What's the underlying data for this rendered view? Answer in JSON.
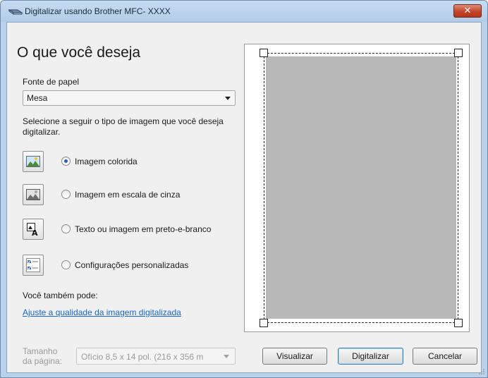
{
  "window": {
    "title": "Digitalizar usando Brother MFC- XXXX",
    "close_label": "✕"
  },
  "main": {
    "heading": "O que você deseja",
    "paper_source_label": "Fonte de papel",
    "paper_source_value": "Mesa",
    "instruction": "Selecione a seguir o tipo de imagem que você deseja digitalizar.",
    "image_types": [
      {
        "label": "Imagem colorida",
        "selected": true,
        "icon": "color-picture-icon"
      },
      {
        "label": "Imagem em escala de cinza",
        "selected": false,
        "icon": "grayscale-picture-icon"
      },
      {
        "label": "Texto ou imagem em preto-e-branco",
        "selected": false,
        "icon": "black-white-text-icon"
      },
      {
        "label": "Configurações personalizadas",
        "selected": false,
        "icon": "custom-settings-icon"
      }
    ],
    "also_label": "Você também pode:",
    "adjust_link": "Ajuste a qualidade da imagem digitalizada",
    "page_size_label_line1": "Tamanho",
    "page_size_label_line2": "da página:",
    "page_size_value": "Ofício 8,5 x 14 pol. (216 x 356 m"
  },
  "buttons": {
    "preview": "Visualizar",
    "scan": "Digitalizar",
    "cancel": "Cancelar"
  },
  "colors": {
    "title_bar": "#b9d1ea",
    "close_button": "#c2452b",
    "link": "#1a66c2",
    "preview_scan_area": "#b8b8b8"
  }
}
